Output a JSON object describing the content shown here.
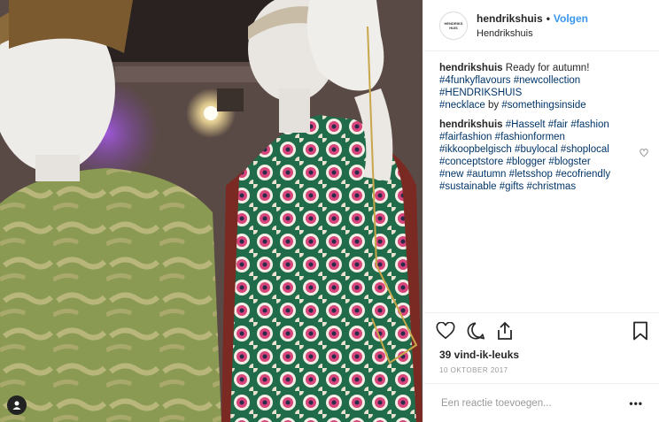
{
  "post": {
    "username": "hendrikshuis",
    "separator": "•",
    "follow_label": "Volgen",
    "location": "Hendrikshuis",
    "avatar_text": "HENDRIKS HUIS"
  },
  "caption": {
    "username": "hendrikshuis",
    "text": "Ready for autumn!",
    "tags": [
      "#4funkyflavours",
      "#newcollection",
      "#HENDRIKSHUIS",
      "#necklace",
      "by",
      "#somethingsinside"
    ]
  },
  "comment_hashtags": {
    "username": "hendrikshuis",
    "tags": [
      "#Hasselt",
      "#fair",
      "#fashion",
      "#fairfashion",
      "#fashionformen",
      "#ikkoopbelgisch",
      "#buylocal",
      "#shoplocal",
      "#conceptstore",
      "#blogger",
      "#blogster",
      "#new",
      "#autumn",
      "#letsshop",
      "#ecofriendly",
      "#sustainable",
      "#gifts",
      "#christmas"
    ]
  },
  "likes_text": "39 vind-ik-leuks",
  "date_text": "10 OKTOBER 2017",
  "comment_placeholder": "Een reactie toevoegen...",
  "more_label": "•••",
  "icons": {
    "like": "heart-icon",
    "comment": "comment-icon",
    "share": "share-icon",
    "save": "bookmark-icon",
    "user_tag": "user-icon"
  }
}
